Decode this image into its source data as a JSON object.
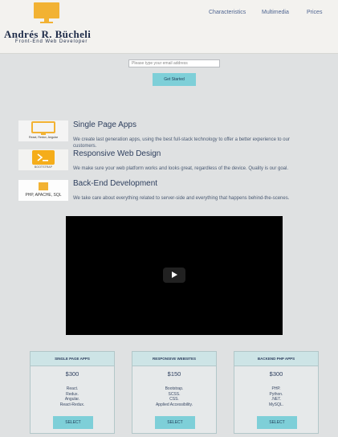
{
  "header": {
    "logo_name": "Andrés R. Bücheli",
    "logo_tagline": "Front-End Web Developer",
    "nav": [
      "Characteristics",
      "Multimedia",
      "Prices"
    ]
  },
  "signup": {
    "email_placeholder": "Please type your email address",
    "cta_label": "Get Started"
  },
  "features": [
    {
      "image_label": "React, Redux, Angular",
      "title": "Single Page Apps",
      "description": "We create last generation apps, using the best full-stack technology to offer a better experience to our customers."
    },
    {
      "image_label": "BOOTSTRAP",
      "title": "Responsive Web Design",
      "description": "We make sure your web platform works and looks great, regardless of the device. Quality is our goal."
    },
    {
      "image_label": "PHP, APACHE, SQL",
      "title": "Back-End Development",
      "description": "We take care about everything related to server-side and everything that happens behind-the-scenes."
    }
  ],
  "pricing": [
    {
      "title": "SINGLE PAGE APPS",
      "price": "$300",
      "items": [
        "React.",
        "Redux.",
        "Angular.",
        "React-Redux."
      ],
      "button": "SELECT"
    },
    {
      "title": "RESPONSIVE WEBSITES",
      "price": "$150",
      "items": [
        "Bootstrap.",
        "SCSS.",
        "CSS.",
        "Applied Accessibility."
      ],
      "button": "SELECT"
    },
    {
      "title": "BACKEND PHP APPS",
      "price": "$300",
      "items": [
        "PHP.",
        "Python.",
        ".NET.",
        "MySQL."
      ],
      "button": "SELECT"
    }
  ],
  "colors": {
    "background": "#dfe1e2",
    "header": "#f3f2ef",
    "accent": "#7ecfd8",
    "logo": "#f2b233"
  }
}
